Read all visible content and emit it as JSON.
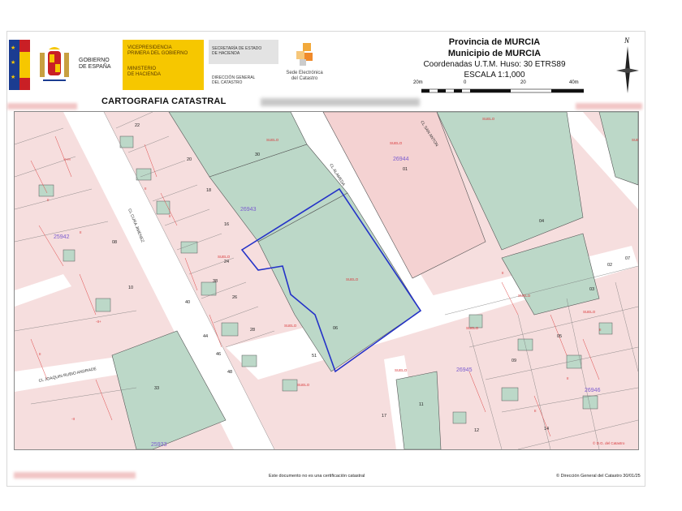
{
  "header": {
    "gobierno": [
      "GOBIERNO",
      "DE ESPAÑA"
    ],
    "vicepresidencia": [
      "VICEPRESIDENCIA",
      "PRIMERA DEL GOBIERNO"
    ],
    "ministerio": [
      "MINISTERIO",
      "DE HACIENDA"
    ],
    "secretaria": [
      "SECRETARÍA DE ESTADO",
      "DE HACIENDA"
    ],
    "direccion": [
      "DIRECCIÓN GENERAL",
      "DEL CATASTRO"
    ],
    "sede": [
      "Sede Electrónica",
      "del Catastro"
    ],
    "provincia": "Provincia de MURCIA",
    "municipio": "Municipio de MURCIA",
    "coordenadas": "Coordenadas U.T.M. Huso: 30 ETRS89",
    "escala": "ESCALA 1:1,000",
    "scale_labels": [
      "20m",
      "0",
      "20",
      "40m"
    ],
    "north_label": "N",
    "cartografia": "CARTOGRAFIA CATASTRAL"
  },
  "map": {
    "blocks": [
      "26943",
      "26944",
      "25942",
      "26945",
      "26946",
      "25933"
    ],
    "streets": [
      "CL CURA JIMENEZ",
      "CL ALAMEDA",
      "CL JOAQUIN RUBIO ANDRADE",
      "CL SAN ANTON"
    ],
    "parcel_numbers": [
      "01",
      "04",
      "06",
      "08",
      "10",
      "17",
      "30",
      "33",
      "51",
      "02",
      "03",
      "05",
      "07",
      "09",
      "11",
      "12",
      "14",
      "16",
      "18",
      "20",
      "22",
      "24",
      "26",
      "28",
      "38",
      "40",
      "44",
      "46",
      "48"
    ],
    "copyright_in_map": "© D.G. del Catastro",
    "colors": {
      "green_parcel": "#bcd8c8",
      "pink_parcel": "#f4d8d8",
      "red_lines": "#e04848",
      "blue_highlight": "#2432c8",
      "street": "#ffffff"
    }
  },
  "footer": {
    "disclaimer": "Este documento no es una certificación catastral",
    "copyright": "© Dirección General del Catastro 30/01/25"
  }
}
